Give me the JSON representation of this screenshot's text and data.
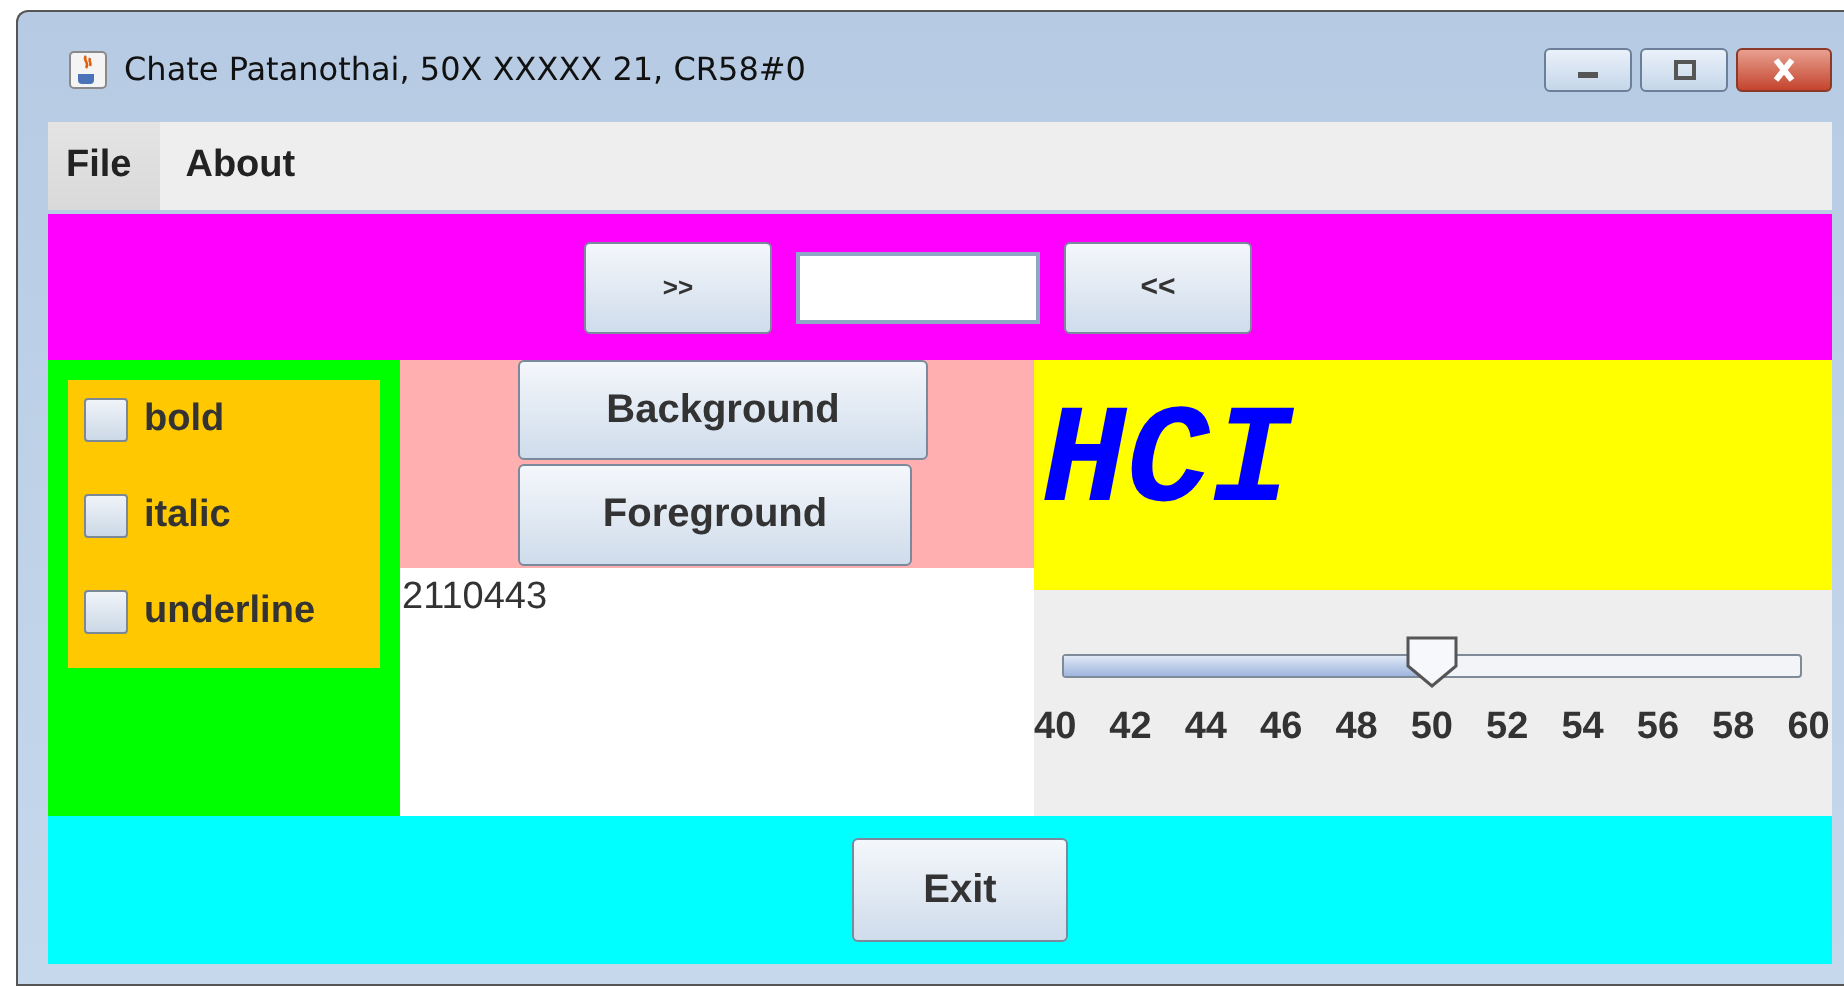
{
  "window": {
    "title": "Chate Patanothai, 50X XXXXX 21, CR58#0"
  },
  "menu": [
    {
      "label": "File",
      "selected": true
    },
    {
      "label": "About",
      "selected": false
    }
  ],
  "top_bar": {
    "next_button": ">>",
    "prev_button": "<<"
  },
  "style_options": [
    {
      "label": "bold",
      "checked": false
    },
    {
      "label": "italic",
      "checked": false
    },
    {
      "label": "underline",
      "checked": false
    }
  ],
  "color_buttons": [
    "Background",
    "Foreground"
  ],
  "output_text": "2110443",
  "preview_text": "HCI",
  "size_slider": {
    "level": 0.5,
    "labels": [
      "40",
      "42",
      "44",
      "46",
      "48",
      "50",
      "52",
      "54",
      "56",
      "58",
      "60"
    ]
  },
  "exit_button": "Exit"
}
